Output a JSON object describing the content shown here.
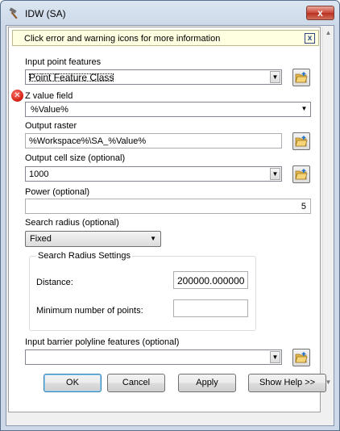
{
  "window": {
    "title": "IDW (SA)",
    "close_label": "x"
  },
  "message_bar": {
    "text": "Click error and warning icons for more information",
    "close_label": "x"
  },
  "params": {
    "input_point": {
      "label": "Input point features",
      "value": "Point Feature Class"
    },
    "z_value": {
      "label": "Z value field",
      "value": "%Value%"
    },
    "output_raster": {
      "label": "Output raster",
      "value": "%Workspace%\\SA_%Value%"
    },
    "cell_size": {
      "label": "Output cell size (optional)",
      "value": "1000"
    },
    "power": {
      "label": "Power (optional)",
      "value": "5"
    },
    "search_radius": {
      "label": "Search radius (optional)",
      "value": "Fixed"
    },
    "search_settings": {
      "title": "Search Radius Settings",
      "distance_label": "Distance:",
      "distance_value": "200000.000000",
      "min_points_label": "Minimum number of points:",
      "min_points_value": ""
    },
    "barrier": {
      "label": "Input barrier polyline features (optional)",
      "value": ""
    }
  },
  "buttons": {
    "ok": "OK",
    "cancel": "Cancel",
    "apply": "Apply",
    "help": "Show Help >>"
  }
}
